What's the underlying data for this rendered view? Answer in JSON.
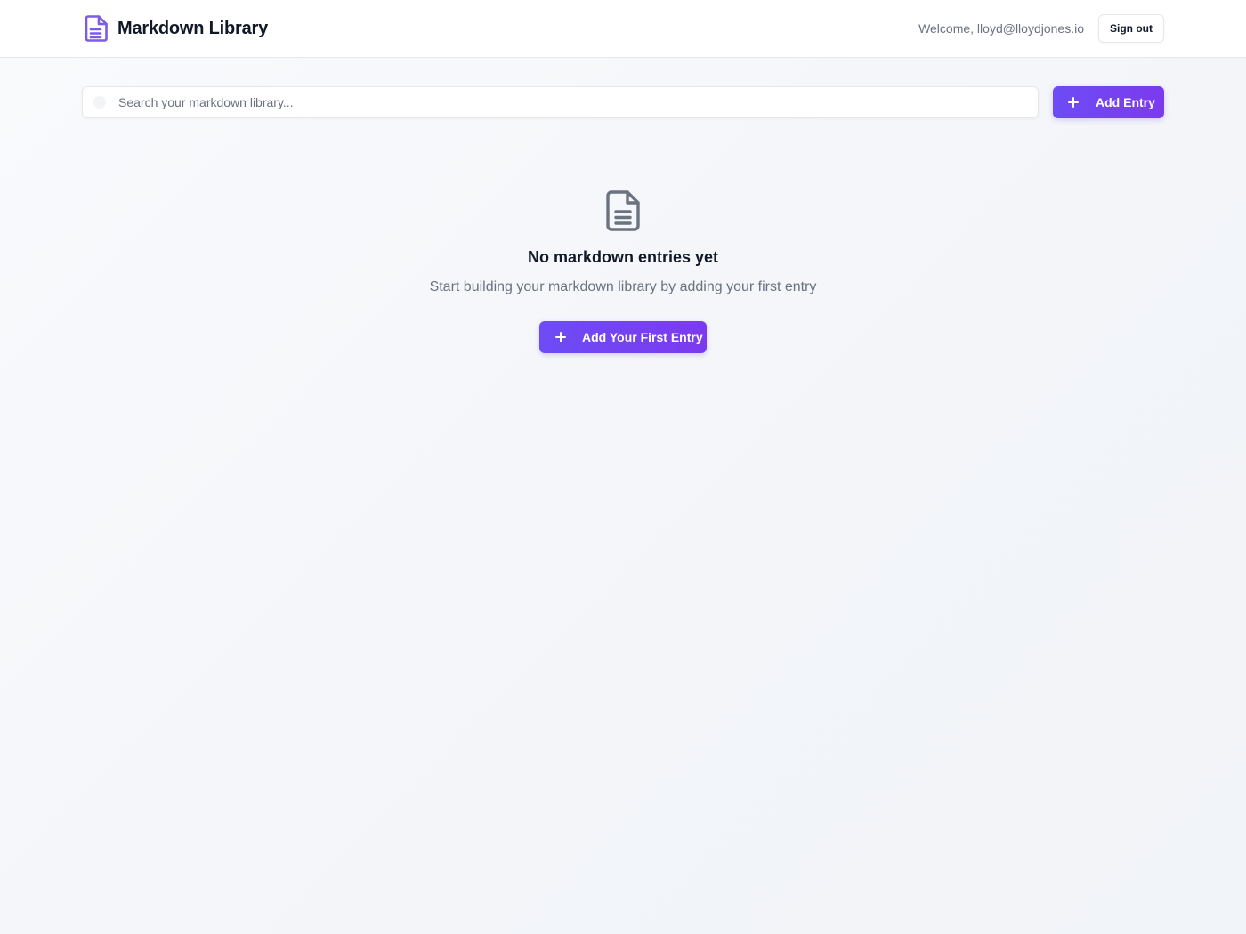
{
  "header": {
    "brand_icon": "document-icon",
    "title": "Markdown Library",
    "welcome": "Welcome, lloyd@lloydjones.io",
    "sign_out_label": "Sign out"
  },
  "toolbar": {
    "search_placeholder": "Search your markdown library...",
    "search_value": "",
    "add_entry_label": "Add Entry"
  },
  "empty_state": {
    "icon": "document-icon",
    "title": "No markdown entries yet",
    "subtitle": "Start building your markdown library by adding your first entry",
    "button_label": "Add Your First Entry"
  },
  "colors": {
    "accent": "#6d4cf5",
    "accent_end": "#7c3aed",
    "brand_icon": "#7c5ce6",
    "empty_icon": "#6b7280",
    "text_primary": "#111827",
    "text_muted": "#6b7280"
  }
}
